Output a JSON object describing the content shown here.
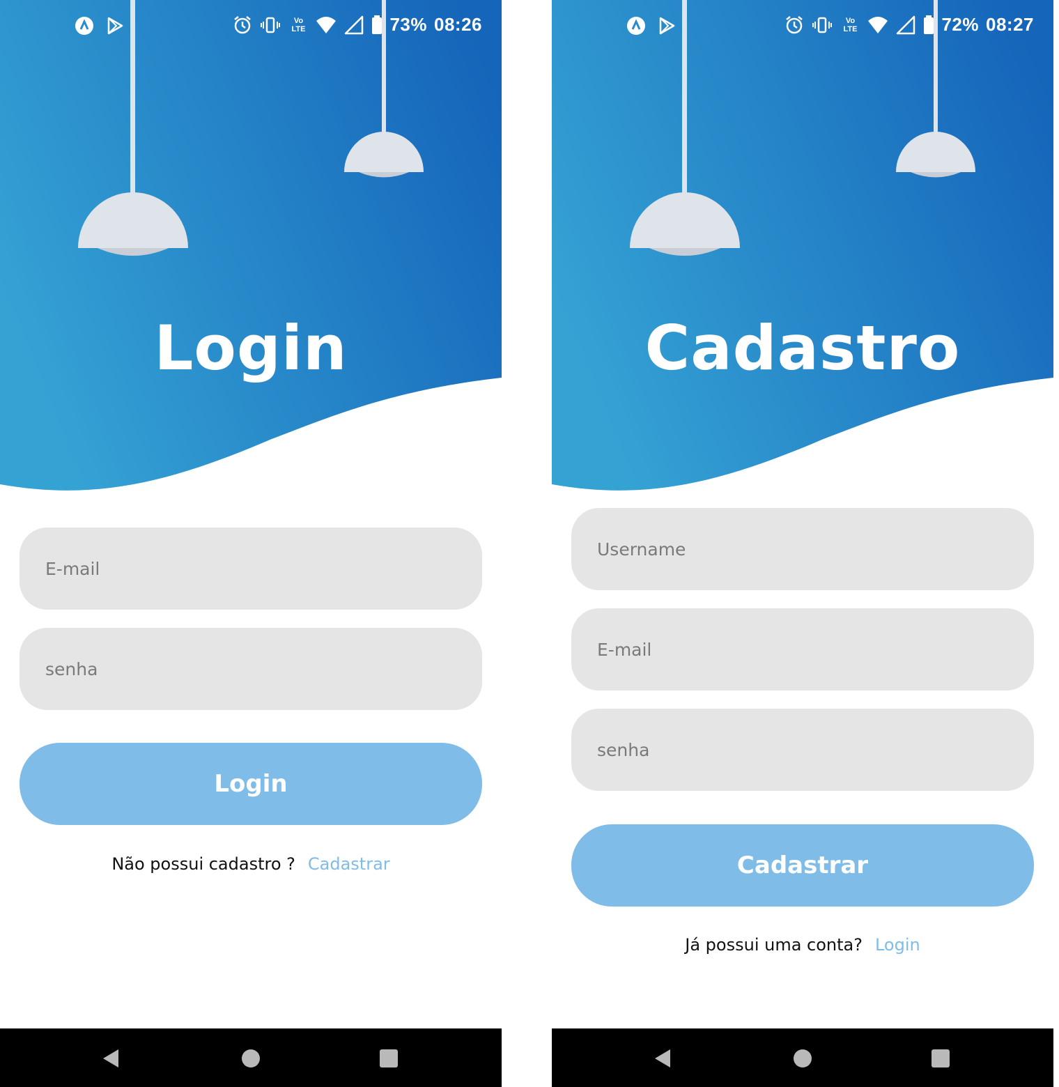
{
  "login_screen": {
    "status_bar": {
      "battery": "73%",
      "time": "08:26",
      "volte": "LTE"
    },
    "title": "Login",
    "email_placeholder": "E-mail",
    "password_placeholder": "senha",
    "submit_label": "Login",
    "footer_prompt": "Não possui cadastro ?",
    "footer_link": "Cadastrar"
  },
  "register_screen": {
    "status_bar": {
      "battery": "72%",
      "time": "08:27",
      "volte": "LTE"
    },
    "title": "Cadastro",
    "username_placeholder": "Username",
    "email_placeholder": "E-mail",
    "password_placeholder": "senha",
    "submit_label": "Cadastrar",
    "footer_prompt": "Já possui uma conta?",
    "footer_link": "Login"
  },
  "icons": {
    "status_left": [
      "app-a-icon",
      "play-store-icon"
    ],
    "status_right": [
      "alarm-icon",
      "vibrate-icon",
      "volte-icon",
      "wifi-icon",
      "signal-icon",
      "battery-icon"
    ],
    "nav": [
      "back-icon",
      "home-icon",
      "recents-icon"
    ],
    "decor": [
      "pendant-lamp-icon"
    ]
  },
  "colors": {
    "gradient_start": "#35a2d4",
    "gradient_end": "#1565ba",
    "field_bg": "#e5e5e5",
    "button_bg": "#7fbce8",
    "link": "#7fbce8",
    "lamp": "#dfe3ea",
    "nav_bar": "#000000"
  }
}
